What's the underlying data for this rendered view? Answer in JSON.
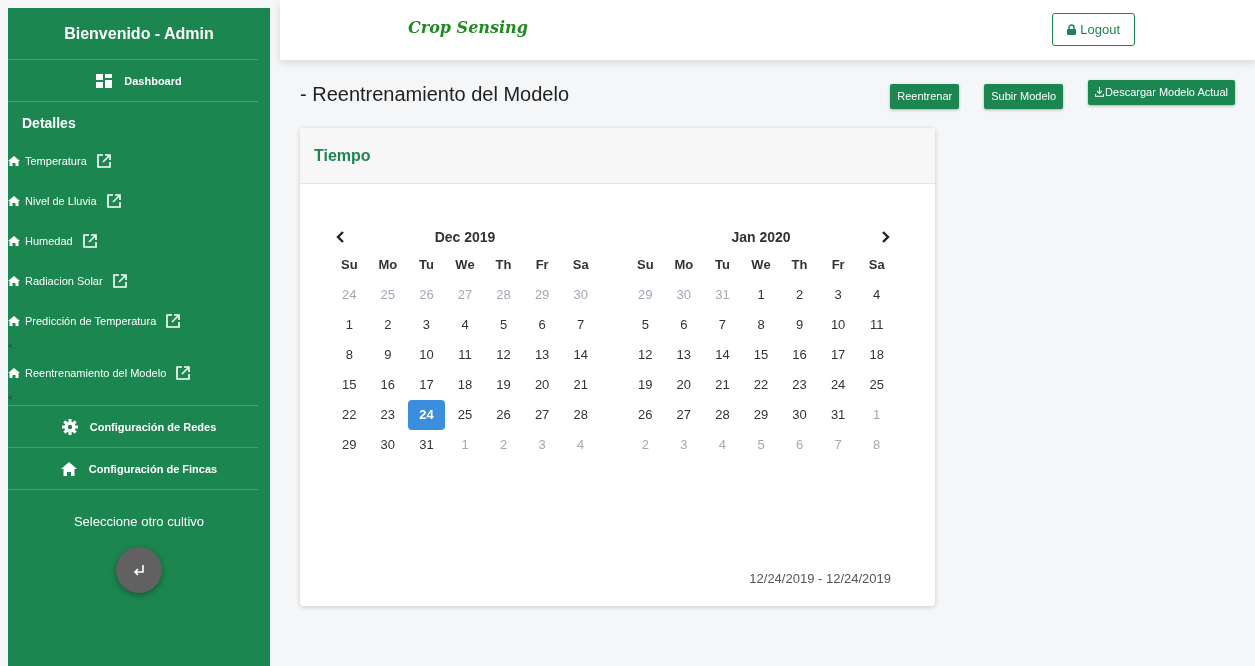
{
  "sidebar": {
    "title": "Bienvenido - Admin",
    "dashboard": "Dashboard",
    "section_title": "Detalles",
    "details": [
      {
        "kind": "link",
        "label": "Temperatura"
      },
      {
        "kind": "link",
        "label": "Nivel de Lluvia"
      },
      {
        "kind": "link",
        "label": "Humedad"
      },
      {
        "kind": "link",
        "label": "Radiacion Solar"
      },
      {
        "kind": "link",
        "label": "Predicción de Temperatura"
      },
      {
        "kind": "caret",
        "label": "<"
      },
      {
        "kind": "link",
        "label": "Reentrenamiento del Modelo"
      },
      {
        "kind": "caret",
        "label": "<"
      }
    ],
    "config": [
      "Configuración de Redes",
      "Configuración de Fincas"
    ],
    "crop_prompt": "Seleccione otro cultivo"
  },
  "topbar": {
    "brand": "Crop Sensing",
    "logout": "Logout"
  },
  "page": {
    "title": "- Reentrenamiento del Modelo",
    "buttons": [
      "Reentrenar",
      "Subir Modelo",
      "Descargar Modelo Actual"
    ]
  },
  "card": {
    "title": "Tiempo",
    "range": "12/24/2019 - 12/24/2019",
    "months": [
      {
        "label": "Dec 2019",
        "weekdays": [
          "Su",
          "Mo",
          "Tu",
          "We",
          "Th",
          "Fr",
          "Sa"
        ],
        "weeks": [
          [
            {
              "day": "24",
              "muted": true,
              "selected": false
            },
            {
              "day": "25",
              "muted": true,
              "selected": false
            },
            {
              "day": "26",
              "muted": true,
              "selected": false
            },
            {
              "day": "27",
              "muted": true,
              "selected": false
            },
            {
              "day": "28",
              "muted": true,
              "selected": false
            },
            {
              "day": "29",
              "muted": true,
              "selected": false
            },
            {
              "day": "30",
              "muted": true,
              "selected": false
            }
          ],
          [
            {
              "day": "1",
              "muted": false,
              "selected": false
            },
            {
              "day": "2",
              "muted": false,
              "selected": false
            },
            {
              "day": "3",
              "muted": false,
              "selected": false
            },
            {
              "day": "4",
              "muted": false,
              "selected": false
            },
            {
              "day": "5",
              "muted": false,
              "selected": false
            },
            {
              "day": "6",
              "muted": false,
              "selected": false
            },
            {
              "day": "7",
              "muted": false,
              "selected": false
            }
          ],
          [
            {
              "day": "8",
              "muted": false,
              "selected": false
            },
            {
              "day": "9",
              "muted": false,
              "selected": false
            },
            {
              "day": "10",
              "muted": false,
              "selected": false
            },
            {
              "day": "11",
              "muted": false,
              "selected": false
            },
            {
              "day": "12",
              "muted": false,
              "selected": false
            },
            {
              "day": "13",
              "muted": false,
              "selected": false
            },
            {
              "day": "14",
              "muted": false,
              "selected": false
            }
          ],
          [
            {
              "day": "15",
              "muted": false,
              "selected": false
            },
            {
              "day": "16",
              "muted": false,
              "selected": false
            },
            {
              "day": "17",
              "muted": false,
              "selected": false
            },
            {
              "day": "18",
              "muted": false,
              "selected": false
            },
            {
              "day": "19",
              "muted": false,
              "selected": false
            },
            {
              "day": "20",
              "muted": false,
              "selected": false
            },
            {
              "day": "21",
              "muted": false,
              "selected": false
            }
          ],
          [
            {
              "day": "22",
              "muted": false,
              "selected": false
            },
            {
              "day": "23",
              "muted": false,
              "selected": false
            },
            {
              "day": "24",
              "muted": false,
              "selected": true
            },
            {
              "day": "25",
              "muted": false,
              "selected": false
            },
            {
              "day": "26",
              "muted": false,
              "selected": false
            },
            {
              "day": "27",
              "muted": false,
              "selected": false
            },
            {
              "day": "28",
              "muted": false,
              "selected": false
            }
          ],
          [
            {
              "day": "29",
              "muted": false,
              "selected": false
            },
            {
              "day": "30",
              "muted": false,
              "selected": false
            },
            {
              "day": "31",
              "muted": false,
              "selected": false
            },
            {
              "day": "1",
              "muted": true,
              "selected": false
            },
            {
              "day": "2",
              "muted": true,
              "selected": false
            },
            {
              "day": "3",
              "muted": true,
              "selected": false
            },
            {
              "day": "4",
              "muted": true,
              "selected": false
            }
          ]
        ]
      },
      {
        "label": "Jan 2020",
        "weekdays": [
          "Su",
          "Mo",
          "Tu",
          "We",
          "Th",
          "Fr",
          "Sa"
        ],
        "weeks": [
          [
            {
              "day": "29",
              "muted": true,
              "selected": false
            },
            {
              "day": "30",
              "muted": true,
              "selected": false
            },
            {
              "day": "31",
              "muted": true,
              "selected": false
            },
            {
              "day": "1",
              "muted": false,
              "selected": false
            },
            {
              "day": "2",
              "muted": false,
              "selected": false
            },
            {
              "day": "3",
              "muted": false,
              "selected": false
            },
            {
              "day": "4",
              "muted": false,
              "selected": false
            }
          ],
          [
            {
              "day": "5",
              "muted": false,
              "selected": false
            },
            {
              "day": "6",
              "muted": false,
              "selected": false
            },
            {
              "day": "7",
              "muted": false,
              "selected": false
            },
            {
              "day": "8",
              "muted": false,
              "selected": false
            },
            {
              "day": "9",
              "muted": false,
              "selected": false
            },
            {
              "day": "10",
              "muted": false,
              "selected": false
            },
            {
              "day": "11",
              "muted": false,
              "selected": false
            }
          ],
          [
            {
              "day": "12",
              "muted": false,
              "selected": false
            },
            {
              "day": "13",
              "muted": false,
              "selected": false
            },
            {
              "day": "14",
              "muted": false,
              "selected": false
            },
            {
              "day": "15",
              "muted": false,
              "selected": false
            },
            {
              "day": "16",
              "muted": false,
              "selected": false
            },
            {
              "day": "17",
              "muted": false,
              "selected": false
            },
            {
              "day": "18",
              "muted": false,
              "selected": false
            }
          ],
          [
            {
              "day": "19",
              "muted": false,
              "selected": false
            },
            {
              "day": "20",
              "muted": false,
              "selected": false
            },
            {
              "day": "21",
              "muted": false,
              "selected": false
            },
            {
              "day": "22",
              "muted": false,
              "selected": false
            },
            {
              "day": "23",
              "muted": false,
              "selected": false
            },
            {
              "day": "24",
              "muted": false,
              "selected": false
            },
            {
              "day": "25",
              "muted": false,
              "selected": false
            }
          ],
          [
            {
              "day": "26",
              "muted": false,
              "selected": false
            },
            {
              "day": "27",
              "muted": false,
              "selected": false
            },
            {
              "day": "28",
              "muted": false,
              "selected": false
            },
            {
              "day": "29",
              "muted": false,
              "selected": false
            },
            {
              "day": "30",
              "muted": false,
              "selected": false
            },
            {
              "day": "31",
              "muted": false,
              "selected": false
            },
            {
              "day": "1",
              "muted": true,
              "selected": false
            }
          ],
          [
            {
              "day": "2",
              "muted": true,
              "selected": false
            },
            {
              "day": "3",
              "muted": true,
              "selected": false
            },
            {
              "day": "4",
              "muted": true,
              "selected": false
            },
            {
              "day": "5",
              "muted": true,
              "selected": false
            },
            {
              "day": "6",
              "muted": true,
              "selected": false
            },
            {
              "day": "7",
              "muted": true,
              "selected": false
            },
            {
              "day": "8",
              "muted": true,
              "selected": false
            }
          ]
        ]
      }
    ]
  }
}
